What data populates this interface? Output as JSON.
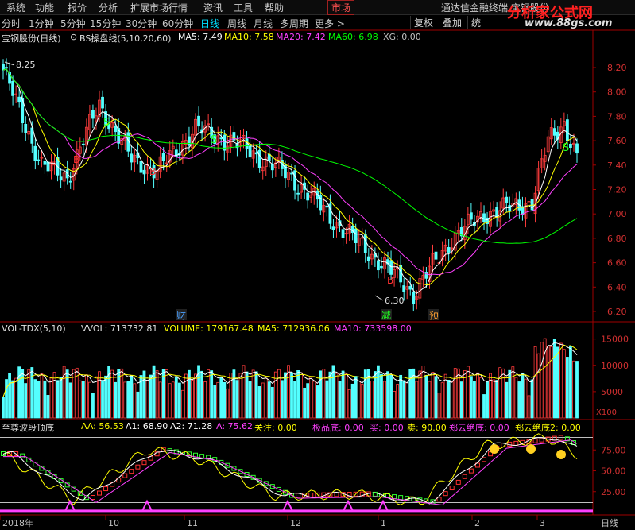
{
  "menu": {
    "items": [
      "系统",
      "功能",
      "报价",
      "分析",
      "扩展市场行情",
      "资讯",
      "工具",
      "帮助"
    ],
    "market_tab": "市场",
    "title_text": "通达信金融终端  宝钢股份"
  },
  "periods": {
    "items": [
      "分时",
      "1分钟",
      "5分钟",
      "15分钟",
      "30分钟",
      "60分钟",
      "日线",
      "周线",
      "月线",
      "多周期",
      "更多 >"
    ],
    "active": "日线",
    "buttons": [
      "复权",
      "叠加",
      "统"
    ]
  },
  "watermark": {
    "brand": "分析家公式网",
    "url": "www.88gs.com"
  },
  "main_panel": {
    "stock": "宝钢股份(日线)",
    "indicator": "BS操盘线(5,10,20,60)",
    "ma5": "MA5: 7.49",
    "ma10": "MA10: 7.58",
    "ma20": "MA20: 7.42",
    "ma60": "MA60: 6.98",
    "xg": "XG: 0.00",
    "high_label": "8.25",
    "low_label": "6.30",
    "y_ticks": [
      "8.20",
      "8.00",
      "7.80",
      "7.60",
      "7.40",
      "7.20",
      "7.00",
      "6.80",
      "6.60",
      "6.40",
      "6.20"
    ],
    "events": [
      "财",
      "减",
      "预"
    ],
    "signal_buy": "B",
    "signal_sell": "S"
  },
  "volume_panel": {
    "name": "VOL-TDX(5,10)",
    "vvol": "VVOL: 713732.81",
    "volume": "VOLUME: 179167.48",
    "ma5": "MA5: 712936.06",
    "ma10": "MA10: 733598.00",
    "y_ticks": [
      "15000",
      "10000",
      "5000"
    ],
    "unit": "X100"
  },
  "osc_panel": {
    "name": "至尊波段顶底",
    "aa": "AA: 56.53",
    "a1": "A1: 68.90",
    "a2": "A2: 71.28",
    "a": "A: 75.62",
    "focus": "关注: 0.00",
    "bottom": "极品底: 0.00",
    "buy": "买: 0.00",
    "sell": "卖: 90.00",
    "zy_bottom": "郑云绝底: 0.00",
    "zy_bottom2": "郑云绝底2: 0.00",
    "y_ticks": [
      "75.00",
      "50.00",
      "25.00"
    ]
  },
  "time_axis": {
    "labels": [
      "2018年",
      "10",
      "11",
      "12",
      "1",
      "2",
      "3"
    ],
    "period_label": "日线"
  },
  "colors": {
    "up": "#ff3c3c",
    "down": "#54ffff",
    "ma5": "#ffffff",
    "ma10": "#ffff00",
    "ma20": "#ff40ff",
    "ma60": "#00ff00",
    "axis": "#a00000"
  }
}
